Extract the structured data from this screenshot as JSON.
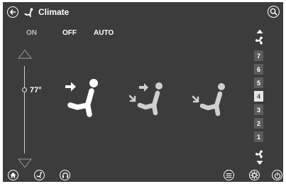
{
  "header": {
    "title": "Climate",
    "back_icon": "back-arrow-icon",
    "title_icon": "climate-icon",
    "search_icon": "search-icon"
  },
  "modes": [
    {
      "label": "ON",
      "selected": true
    },
    {
      "label": "OFF",
      "selected": false
    },
    {
      "label": "AUTO",
      "selected": false
    }
  ],
  "temperature": {
    "value": "77°",
    "up_icon": "triangle-up-icon",
    "down_icon": "triangle-down-icon"
  },
  "airflow": [
    {
      "icon": "airflow-face-icon"
    },
    {
      "icon": "airflow-face-feet-icon"
    },
    {
      "icon": "airflow-feet-icon"
    }
  ],
  "fan": {
    "levels": [
      "7",
      "6",
      "5",
      "4",
      "3",
      "2",
      "1"
    ],
    "selected": "4",
    "up_icon": "fan-increase-icon",
    "down_icon": "fan-decrease-icon"
  },
  "bottom_bar": {
    "left": [
      "home-icon",
      "climate-icon",
      "headphones-icon"
    ],
    "right": [
      "menu-icon",
      "settings-icon",
      "power-icon"
    ]
  },
  "colors": {
    "background": "#3c3c3c",
    "text": "#ffffff",
    "inactive": "#bdbdbd",
    "dim_icon": "#d0d0d0",
    "selected_level": "#e6e6e6",
    "level": "#5c5c5c"
  }
}
